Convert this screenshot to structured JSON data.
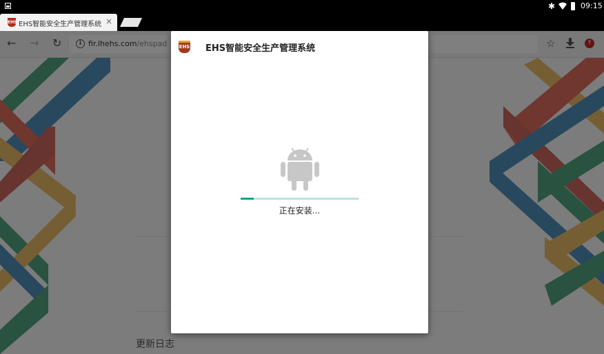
{
  "status_bar": {
    "time": "09:15",
    "icons": [
      "image-notification-icon",
      "bluetooth-icon",
      "wifi-icon",
      "battery-icon"
    ]
  },
  "browser": {
    "tab": {
      "title": "EHS智能安全生产管理系统",
      "favicon_text": "EHS",
      "close_glyph": "×"
    },
    "address_bar": {
      "url_host": "fir.lhehs.com",
      "url_path": "/ehspad"
    },
    "toolbar_icons": [
      "back-icon",
      "forward-icon",
      "reload-icon",
      "star-icon",
      "download-icon",
      "account-icon"
    ]
  },
  "page": {
    "changelog_heading": "更新日志"
  },
  "dialog": {
    "app_icon_text": "EHS",
    "title": "EHS智能安全生产管理系统",
    "progress": 0.11,
    "status": "正在安装..."
  },
  "colors": {
    "progress_fill": "#17a093",
    "progress_track": "#b6e2dd",
    "android_icon": "#c7c7c7",
    "brand_red": "#a33a1d"
  }
}
